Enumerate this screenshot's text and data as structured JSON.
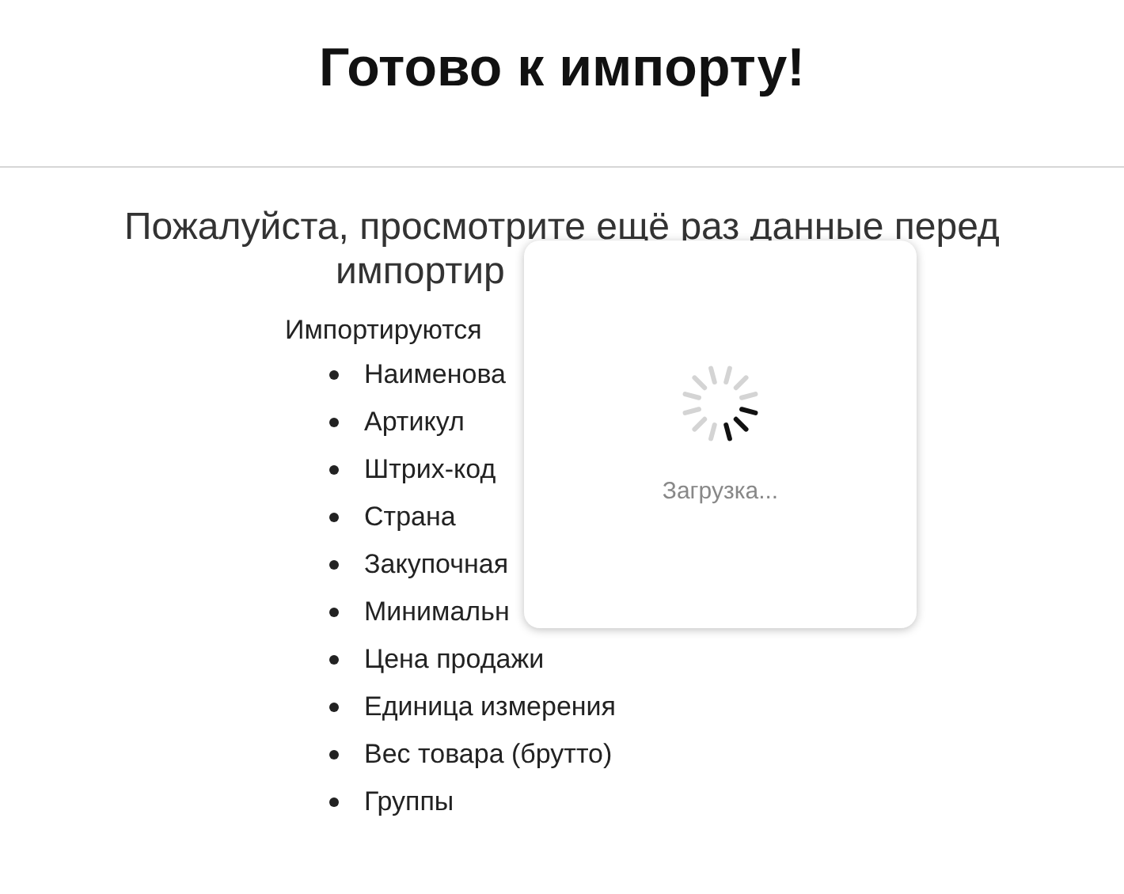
{
  "title": "Готово к импорту!",
  "intro": {
    "line_1": "Пожалуйста, просмотрите ещё раз данные перед",
    "line_2": "импортир"
  },
  "fields_label": "Импортируются",
  "fields": [
    "Наименова",
    "Артикул",
    "Штрих-код",
    "Страна",
    "Закупочная",
    "Минимальн",
    "Цена продажи",
    "Единица измерения",
    "Вес товара (брутто)",
    "Группы"
  ],
  "loading_dialog": {
    "message": "Загрузка..."
  }
}
